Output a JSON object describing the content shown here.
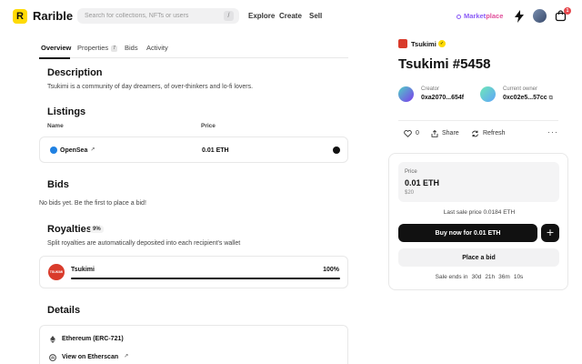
{
  "header": {
    "logo_mark": "R",
    "logo_text": "Rarible",
    "search_placeholder": "Search for collections, NFTs or users",
    "search_shortcut": "/",
    "nav": [
      "Explore",
      "Create",
      "Sell"
    ],
    "marketplace_prefix": "Market",
    "marketplace_suffix": "place",
    "cart_count": "1"
  },
  "tabs": [
    {
      "label": "Overview",
      "active": true
    },
    {
      "label": "Properties",
      "badge": "7"
    },
    {
      "label": "Bids"
    },
    {
      "label": "Activity"
    }
  ],
  "description": {
    "title": "Description",
    "text": "Tsukimi is a community of day dreamers, of over-thinkers and lo-fi lovers."
  },
  "listings": {
    "title": "Listings",
    "col_name": "Name",
    "col_price": "Price",
    "row": {
      "marketplace": "OpenSea",
      "ext": "↗",
      "price": "0.01 ETH"
    }
  },
  "bids": {
    "title": "Bids",
    "empty_text": "No bids yet. Be the first to place a bid!"
  },
  "royalties": {
    "title": "Royalties",
    "badge": "9%",
    "text": "Split royalties are automatically deposited into each recipient's wallet",
    "recipient": {
      "logo_text": "TSUKIMI",
      "name": "Tsukimi",
      "percent": "100%",
      "share": 1.0
    }
  },
  "details": {
    "title": "Details",
    "chain": "Ethereum (ERC-721)",
    "etherscan": "View on Etherscan",
    "ext": "↗"
  },
  "nft": {
    "collection": "Tsukimi",
    "verified_mark": "✓",
    "title": "Tsukimi #5458",
    "creator_label": "Creator",
    "creator_addr": "0xa2070...654f",
    "owner_label": "Current owner",
    "owner_addr": "0xc02e5...57cc",
    "likes": "0",
    "share": "Share",
    "refresh": "Refresh",
    "more": "···"
  },
  "buy": {
    "price_label": "Price",
    "price_eth": "0.01 ETH",
    "price_usd": "$20",
    "last_sale": "Last sale price 0.0184 ETH",
    "buy_label": "Buy now for 0.01 ETH",
    "cart_label": "+",
    "bid_label": "Place a bid",
    "sale_ends_label": "Sale ends in",
    "countdown": [
      "30d",
      "21h",
      "36m",
      "10s"
    ]
  },
  "colors": {
    "brand_yellow": "#FEDA03",
    "marketplace_purple": "#8b5cf6",
    "tsukimi_red": "#d93b2b",
    "primary_button": "#111111"
  }
}
